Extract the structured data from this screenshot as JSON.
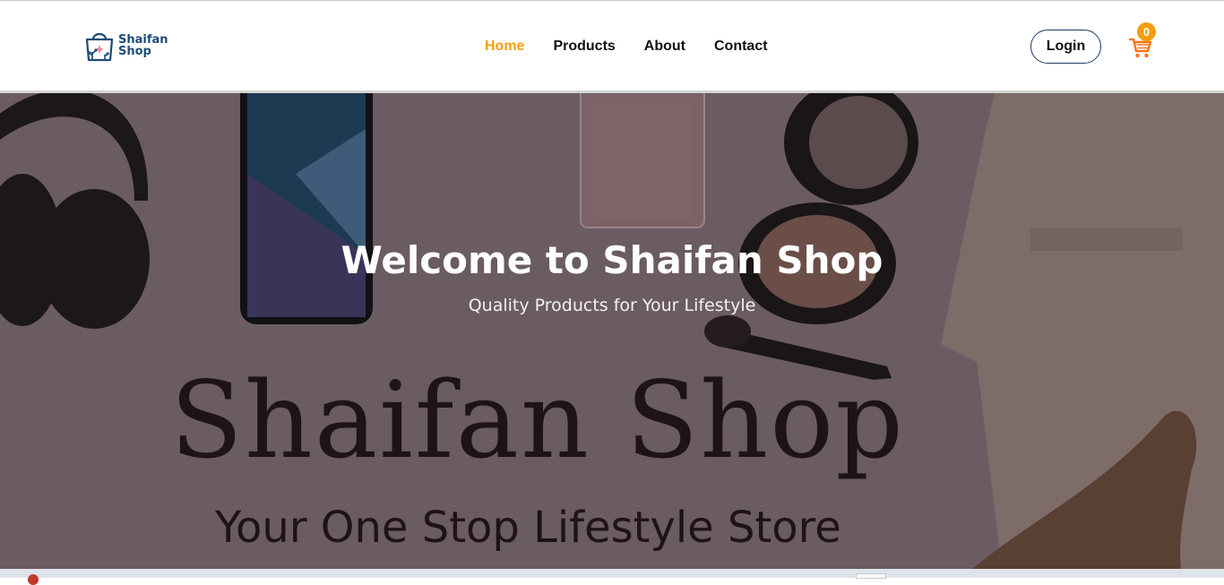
{
  "brand": {
    "name_line1": "Shaifan",
    "name_line2": "Shop",
    "color": "#1f4c78",
    "logo_icon": "shopping-bag-icon"
  },
  "nav": {
    "items": [
      {
        "label": "Home",
        "active": true
      },
      {
        "label": "Products",
        "active": false
      },
      {
        "label": "About",
        "active": false
      },
      {
        "label": "Contact",
        "active": false
      }
    ],
    "active_color": "#f59e0b"
  },
  "header": {
    "login_label": "Login",
    "cart_icon": "shopping-cart-icon",
    "cart_count": "0",
    "cart_color": "#f97316"
  },
  "hero": {
    "title": "Welcome to Shaifan Shop",
    "subtitle": "Quality Products for Your Lifestyle",
    "background_brand": "Shaifan Shop",
    "background_tagline": "Your One Stop Lifestyle Store",
    "overlay_color": "#6b5b62"
  }
}
